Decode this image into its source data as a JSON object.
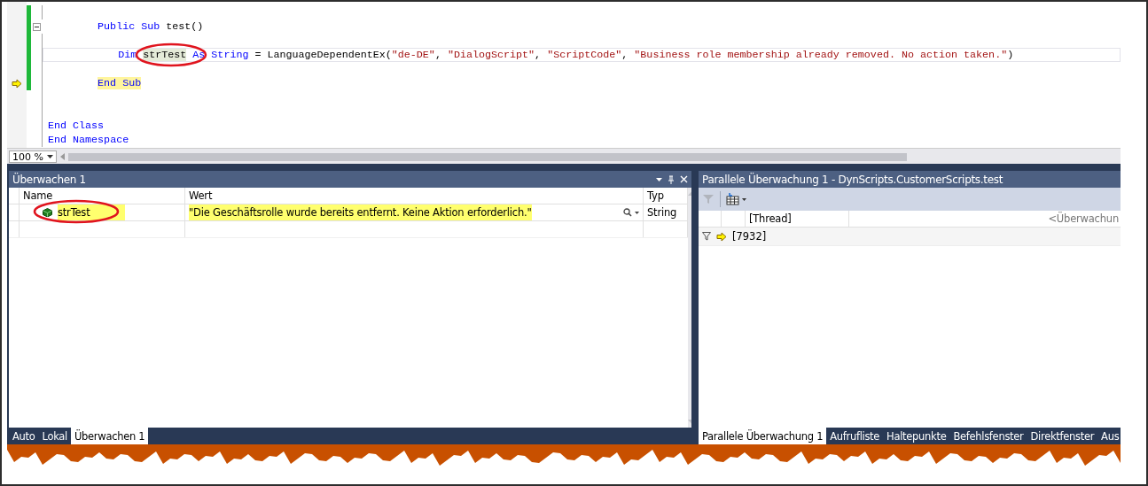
{
  "editor": {
    "lines": [
      {
        "collapse": false,
        "kind": "blank"
      },
      {
        "current": false,
        "focused": false,
        "collapse": true,
        "kind": "member",
        "tokens": [
          {
            "text": "Public Sub",
            "kind": "keyword"
          },
          {
            "text": " test()",
            "kind": "plain"
          }
        ]
      },
      {
        "collapse": false,
        "kind": "blank"
      },
      {
        "current": false,
        "focused": true,
        "collapse": false,
        "kind": "statement",
        "tokens": [
          {
            "text": "Dim",
            "kind": "keyword"
          },
          {
            "text": "strTest",
            "kind": "circled"
          },
          {
            "text": "As String",
            "kind": "keyword"
          },
          {
            "text": " = LanguageDependentEx(",
            "kind": "plain"
          },
          {
            "text": "\"de-DE\"",
            "kind": "string"
          },
          {
            "text": ", ",
            "kind": "plain"
          },
          {
            "text": "\"DialogScript\"",
            "kind": "string"
          },
          {
            "text": ", ",
            "kind": "plain"
          },
          {
            "text": "\"ScriptCode\"",
            "kind": "string"
          },
          {
            "text": ", ",
            "kind": "plain"
          },
          {
            "text": "\"Business role membership already removed. No action taken.\"",
            "kind": "string"
          },
          {
            "text": ")",
            "kind": "plain"
          }
        ]
      },
      {
        "collapse": false,
        "kind": "blank"
      },
      {
        "current": true,
        "focused": false,
        "collapse": false,
        "kind": "member",
        "tokens": [
          {
            "text": "End Sub",
            "kind": "keyword"
          }
        ]
      },
      {
        "collapse": false,
        "kind": "blank"
      },
      {
        "collapse": false,
        "kind": "blank"
      },
      {
        "current": false,
        "focused": false,
        "collapse": false,
        "kind": "declaration",
        "tokens": [
          {
            "text": "End Class",
            "kind": "keyword"
          }
        ]
      },
      {
        "current": false,
        "focused": false,
        "collapse": false,
        "kind": "declaration",
        "tokens": [
          {
            "text": "End Namespace",
            "kind": "keyword"
          }
        ]
      }
    ],
    "zoom": "100 %"
  },
  "watch": {
    "title": "Überwachen 1",
    "columns": [
      "Name",
      "Wert",
      "Typ"
    ],
    "rows": [
      {
        "name": "strTest",
        "value": "\"Die Geschäftsrolle wurde bereits entfernt. Keine Aktion erforderlich.\"",
        "type": "String",
        "highlighted": true,
        "circled": true
      }
    ],
    "tabs": [
      {
        "label": "Auto",
        "selected": false
      },
      {
        "label": "Lokal",
        "selected": false
      },
      {
        "label": "Überwachen 1",
        "selected": true
      }
    ]
  },
  "parallel": {
    "title": "Parallele Überwachung 1 - DynScripts.CustomerScripts.test",
    "columns": [
      "[Thread]",
      "<Überwachun"
    ],
    "rows": [
      {
        "thread": "[7932]",
        "current": true
      }
    ],
    "tabs": [
      {
        "label": "Parallele Überwachung 1",
        "selected": true
      },
      {
        "label": "Aufrufliste",
        "selected": false
      },
      {
        "label": "Haltepunkte",
        "selected": false
      },
      {
        "label": "Befehlsfenster",
        "selected": false
      },
      {
        "label": "Direktfenster",
        "selected": false
      },
      {
        "label": "Aus",
        "selected": false
      }
    ]
  }
}
